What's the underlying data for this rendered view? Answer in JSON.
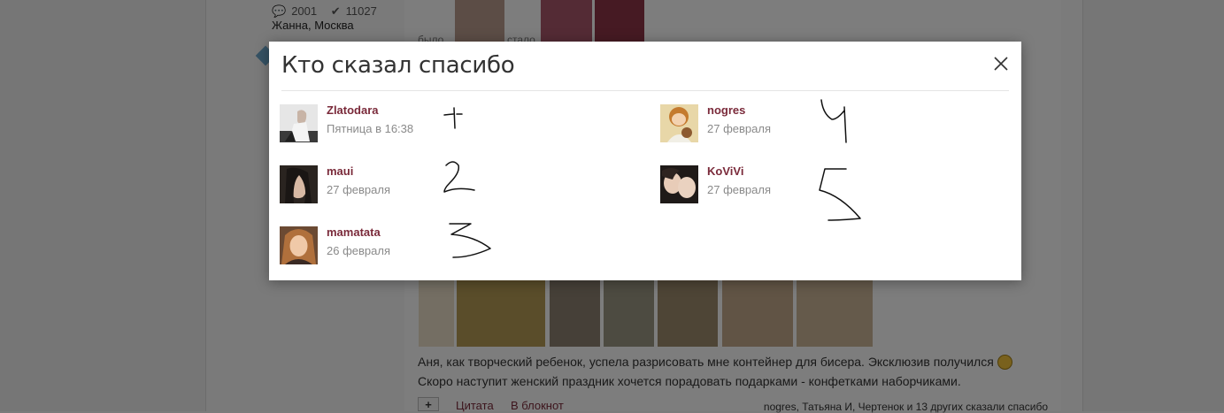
{
  "background": {
    "stats": {
      "comments": "2001",
      "thanks": "11027"
    },
    "author": "Жанна, Москва",
    "caption_before": "было",
    "caption_after": "стало",
    "post_text_line1": "Аня, как творческий ребенок, успела разрисовать мне контейнер для бисера. Эксклюзив получился",
    "post_text_line2": "Скоро наступит женский праздник хочется порадовать подарками - конфетками наборчиками.",
    "toolbar": {
      "plus_label": "+",
      "quote_label": "Цитата",
      "notebook_label": "В блокнот",
      "thanked_by": "nogres, Татьяна И, Чертенок и 13 других сказали спасибо"
    }
  },
  "modal": {
    "title": "Кто сказал спасибо",
    "close_icon": "close-icon",
    "users": [
      {
        "name": "Zlatodara",
        "date": "Пятница в 16:38",
        "annotation": "1"
      },
      {
        "name": "maui",
        "date": "27 февраля",
        "annotation": "2"
      },
      {
        "name": "mamatata",
        "date": "26 февраля",
        "annotation": "3"
      },
      {
        "name": "nogres",
        "date": "27 февраля",
        "annotation": "4"
      },
      {
        "name": "KoViVi",
        "date": "27 февраля",
        "annotation": "5"
      }
    ]
  },
  "colors": {
    "username": "#7a2a3a",
    "date": "#8a8a8a",
    "overlay": "rgba(0,0,0,0.5)"
  }
}
